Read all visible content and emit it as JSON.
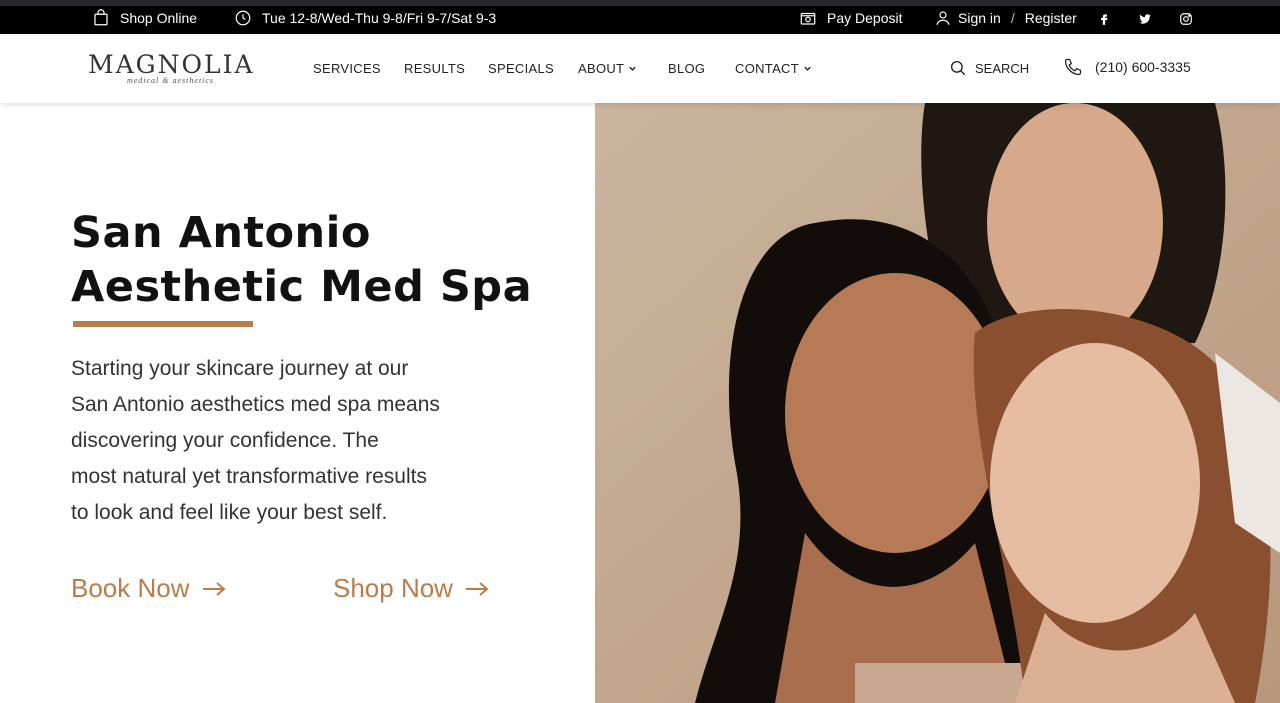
{
  "topbar": {
    "shop_online": "Shop Online",
    "hours": "Tue 12-8/Wed-Thu 9-8/Fri 9-7/Sat 9-3",
    "pay_deposit": "Pay Deposit",
    "sign_in": "Sign in",
    "separator": "/",
    "register": "Register"
  },
  "logo": {
    "main": "MAGNOLIA",
    "sub": "medical & aesthetics"
  },
  "nav": {
    "services": "SERVICES",
    "results": "RESULTS",
    "specials": "SPECIALS",
    "about": "ABOUT",
    "blog": "BLOG",
    "contact": "CONTACT"
  },
  "search_label": "SEARCH",
  "phone": "(210) 600-3335",
  "hero": {
    "title_line1": "San Antonio",
    "title_line2": "Aesthetic Med Spa",
    "text_lines": [
      "Starting your skincare journey at our",
      "San Antonio aesthetics med spa means",
      "discovering your confidence. The",
      "most natural yet transformative results",
      "to look and feel like your best self."
    ],
    "book_now": "Book Now",
    "shop_now": "Shop Now"
  },
  "colors": {
    "accent": "#b87d4b",
    "topbar_bg": "#000000"
  }
}
